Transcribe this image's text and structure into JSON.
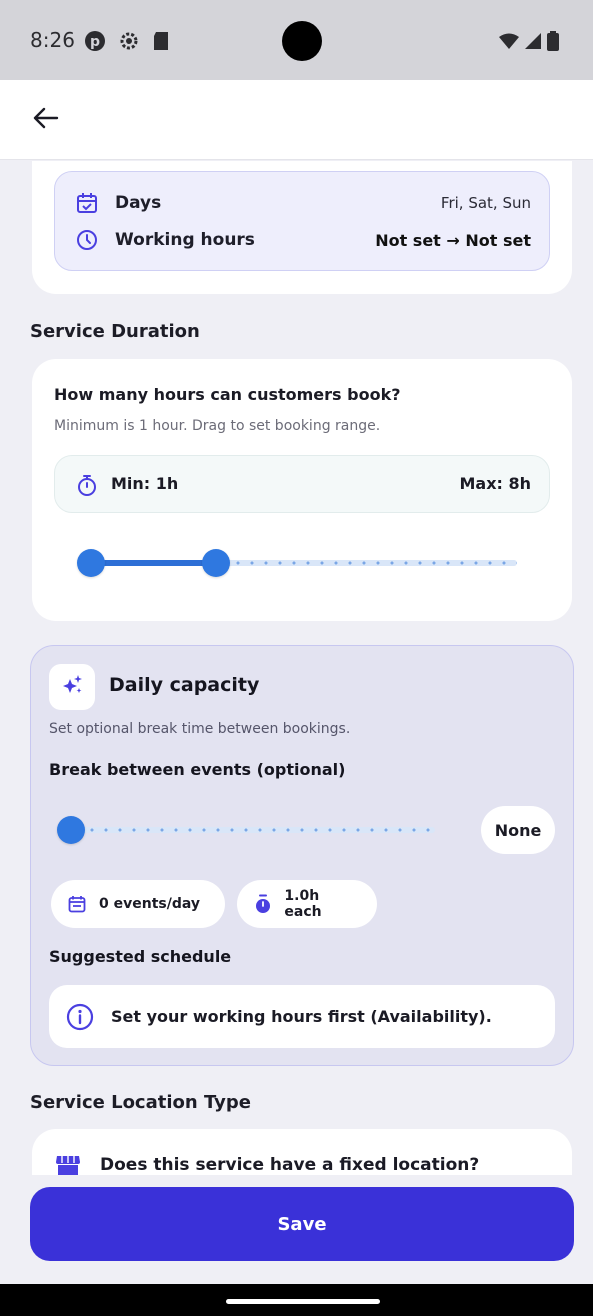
{
  "status_bar": {
    "time": "8:26",
    "left_icons": [
      "pinterest-icon",
      "settings-gear-icon",
      "sd-card-icon"
    ],
    "right_icons": [
      "wifi-icon",
      "signal-icon",
      "battery-icon"
    ]
  },
  "app_bar": {
    "back_icon": "arrow-left-icon"
  },
  "availability": {
    "days_label": "Days",
    "days_value": "Fri, Sat, Sun",
    "hours_label": "Working hours",
    "hours_value": "Not set → Not set"
  },
  "service_duration": {
    "section_title": "Service Duration",
    "question": "How many hours can customers book?",
    "subtitle": "Minimum is 1 hour. Drag to set booking range.",
    "min_label": "Min: 1h",
    "max_label": "Max: 8h",
    "range_min_hours": 1,
    "range_max_hours": 24,
    "selected_min_hours": 1,
    "selected_max_hours": 8
  },
  "daily_capacity": {
    "title": "Daily capacity",
    "subtitle": "Set optional break time between bookings.",
    "break_label": "Break between events (optional)",
    "break_value_label": "None",
    "break_level": 0,
    "events_chip": "0 events/day",
    "duration_chip": "1.0h each",
    "suggested_title": "Suggested schedule",
    "info_text": "Set your working hours first (Availability)."
  },
  "service_location": {
    "section_title": "Service Location Type",
    "question": "Does this service have a fixed location?"
  },
  "save_label": "Save",
  "colors": {
    "primary": "#3a31d8",
    "slider_blue": "#2f78e0",
    "accent_purple": "#4a3fe0",
    "capacity_bg": "#e3e3f1"
  }
}
